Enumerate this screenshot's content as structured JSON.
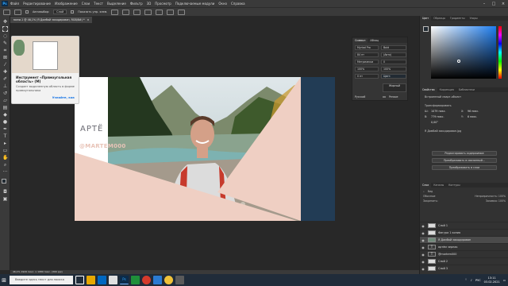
{
  "menubar": {
    "logo": "Ps",
    "items": [
      "Файл",
      "Редактирование",
      "Изображение",
      "Слои",
      "Текст",
      "Выделение",
      "Фильтр",
      "3D",
      "Просмотр",
      "Подключаемые модули",
      "Окно",
      "Справка"
    ]
  },
  "options": {
    "auto_select_label": "Автовыбор:",
    "auto_select_value": "Слой",
    "transform_label": "Показать упр. элем."
  },
  "document_tab": {
    "title": "мини-1 @ 46,1% (Я Домбай закодирован, RGB/8#) *",
    "close": "×"
  },
  "tooltip": {
    "title": "Инструмент «Прямоугольная область» (M)",
    "description": "Создает выделенную область в форме прямоугольника",
    "more": "Узнайте, как"
  },
  "canvas": {
    "brand": "АРТЁ",
    "handle": "@MARTEM000"
  },
  "character_panel": {
    "tabs": [
      "Символ",
      "Абзац"
    ],
    "font": "Myriad Pro",
    "style": "Bold",
    "size": "84 пт",
    "leading": "(Авто)",
    "kerning": "Метрически",
    "tracking": "0",
    "scale_v": "100%",
    "scale_h": "100%",
    "baseline": "0 пт",
    "color_label": "Цвет:",
    "language": "Русский",
    "aa_label": "aa",
    "aa_value": "Резкое",
    "bold_box": "Жирный"
  },
  "status": {
    "text": "46,1%     1920 пикс. x 1080 пикс. (300 ppi)"
  },
  "color_panel": {
    "tabs": [
      "Цвет",
      "Образцы",
      "Градиенты",
      "Узоры"
    ],
    "fg": "#222b33"
  },
  "properties_panel": {
    "tabs": [
      "Свойства",
      "Коррекция",
      "Библиотеки"
    ],
    "type_label": "Встроенный смарт-объект",
    "transform_label": "Трансформировать",
    "w_label": "Ш:",
    "w_value": "1079 пикс.",
    "h_label": "В:",
    "h_value": "779 пикс.",
    "x_label": "X:",
    "x_value": "96 пикс.",
    "y_label": "Y:",
    "y_value": "6 пикс.",
    "angle_value": "0,00°",
    "file_label": "Я Домбай закодирован.jpg",
    "btn_edit": "Редактировать содержимое",
    "btn_convert": "Преобразовать в связанный...",
    "btn_layers": "Преобразовать в слои"
  },
  "layers_panel": {
    "tabs": [
      "Слои",
      "Каналы",
      "Контуры"
    ],
    "filter_label": "Вид",
    "blend_mode": "Обычные",
    "opacity_label": "Непрозрачность:",
    "opacity": "100%",
    "lock_label": "Закрепить:",
    "fill_label": "Заливка:",
    "fill": "100%",
    "rows": [
      {
        "name": "Слой 1",
        "visible": true,
        "kind": "raster"
      },
      {
        "name": "Фигура 1 копия",
        "visible": true,
        "kind": "raster"
      },
      {
        "name": "Я Домбай закодирован",
        "visible": true,
        "kind": "smart",
        "selected": true
      },
      {
        "name": "артём черпак",
        "visible": true,
        "kind": "text"
      },
      {
        "name": "@martem000",
        "visible": true,
        "kind": "text"
      },
      {
        "name": "Слой 2",
        "visible": true,
        "kind": "raster"
      },
      {
        "name": "Слой 3",
        "visible": true,
        "kind": "raster"
      }
    ]
  },
  "taskbar": {
    "search_placeholder": "Введите здесь текст для поиска",
    "lang": "РУС",
    "time": "13:11",
    "date": "03.02.2021"
  }
}
